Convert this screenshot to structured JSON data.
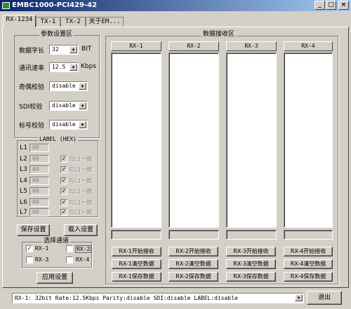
{
  "window": {
    "title": "EMBC1000-PCI429-42",
    "min": "_",
    "max": "□",
    "close": "×"
  },
  "tabs": [
    "RX-1234",
    "TX-1",
    "TX-2",
    "关于EM..."
  ],
  "params": {
    "title": "参数设置区",
    "word_length": {
      "label": "数据字长",
      "value": "32",
      "unit": "BIT"
    },
    "baud": {
      "label": "通讯速率",
      "value": "12.5",
      "unit": "Kbps"
    },
    "parity": {
      "label": "奇偶校验",
      "value": "disable"
    },
    "sdi": {
      "label": "SDI校验",
      "value": "disable"
    },
    "label_check": {
      "label": "标号校验",
      "value": "disable"
    }
  },
  "label_hex": {
    "title": "LABEL (HEX)",
    "rows": [
      {
        "name": "L1",
        "value": "00",
        "check": ""
      },
      {
        "name": "L2",
        "value": "00",
        "check": "与L1一致"
      },
      {
        "name": "L3",
        "value": "00",
        "check": "与L1一致"
      },
      {
        "name": "L4",
        "value": "00",
        "check": "与L1一致"
      },
      {
        "name": "L5",
        "value": "00",
        "check": "与L1一致"
      },
      {
        "name": "L6",
        "value": "00",
        "check": "与L1一致"
      },
      {
        "name": "L7",
        "value": "00",
        "check": "与L1一致"
      }
    ]
  },
  "buttons": {
    "save_settings": "保存设置",
    "load_settings": "载入设置",
    "apply": "应用设置",
    "exit": "退出"
  },
  "channels": {
    "title": "选择通道",
    "items": [
      {
        "label": "RX-1",
        "checked": true
      },
      {
        "label": "RX-2",
        "checked": false
      },
      {
        "label": "RX-3",
        "checked": false
      },
      {
        "label": "RX-4",
        "checked": false
      }
    ]
  },
  "receive": {
    "title": "数据接收区",
    "columns": [
      {
        "name": "RX-1",
        "start": "RX-1开始接收",
        "clear": "RX-1清空数据",
        "save": "RX-1保存数据"
      },
      {
        "name": "RX-2",
        "start": "RX-2开始接收",
        "clear": "RX-2清空数据",
        "save": "RX-2保存数据"
      },
      {
        "name": "RX-3",
        "start": "RX-3开始接收",
        "clear": "RX-3清空数据",
        "save": "RX-3保存数据"
      },
      {
        "name": "RX-4",
        "start": "RX-4开始接收",
        "clear": "RX-4清空数据",
        "save": "RX-4保存数据"
      }
    ]
  },
  "status": {
    "text": "RX-1: 32bit  Rate:12.5Kbps  Parity:disable  SDI:disable  LABEL:disable"
  },
  "icons": {
    "check": "✓",
    "dropdown": "▼"
  }
}
